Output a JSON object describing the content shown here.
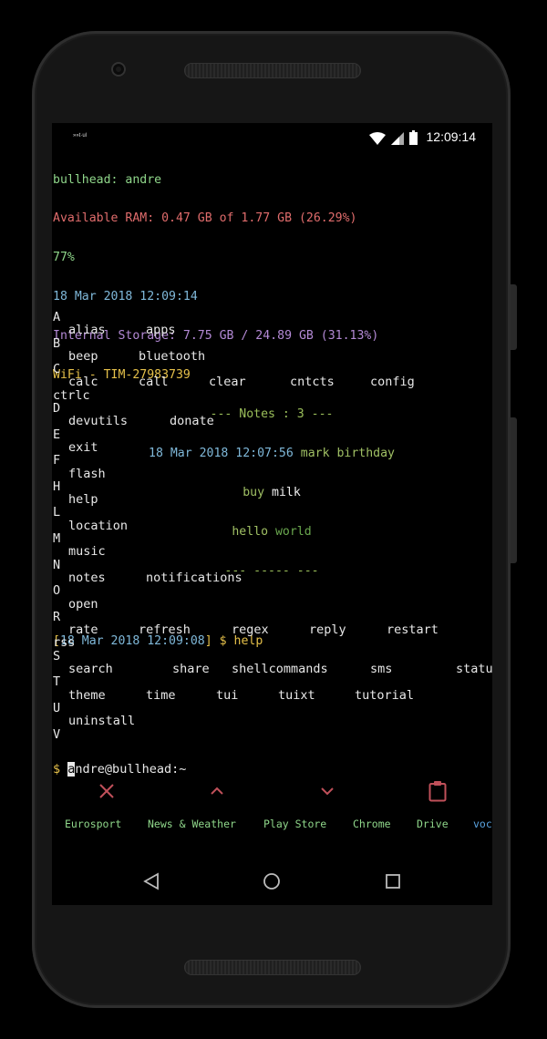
{
  "status_bar": {
    "notification_text": "»»t·ul",
    "clock": "12:09:14",
    "icons": [
      "wifi-icon",
      "signal-icon",
      "battery-icon"
    ]
  },
  "info": {
    "device": "bullhead: andre",
    "ram": "Available RAM: 0.47 GB of 1.77 GB (26.29%)",
    "battery": "77%",
    "datetime": "18 Mar 2018 12:09:14",
    "storage": "Internal Storage: 7.75 GB / 24.89 GB (31.13%)",
    "wifi": "WiFi - TIM-27983739"
  },
  "notes": {
    "header": "--- Notes : 3 ---",
    "note1_date": "18 Mar 2018 12:07:56",
    "note1_text": "mark birthday",
    "note2_a": "buy",
    "note2_b": "milk",
    "note3_a": "hello",
    "note3_b": "world",
    "footer": "--- ----- ---"
  },
  "command": {
    "open_bracket": "[",
    "timestamp": "18 Mar 2018 12:09:08",
    "close_bracket": "]",
    "prompt": "$ help"
  },
  "help": {
    "A": [
      "alias",
      "apps"
    ],
    "B": [
      "beep",
      "bluetooth"
    ],
    "C": [
      "calc",
      "call",
      "clear",
      "cntcts",
      "config"
    ],
    "C_overflow": "ctrlc",
    "D": [
      "devutils",
      "donate"
    ],
    "E": [
      "exit"
    ],
    "F": [
      "flash"
    ],
    "H": [
      "help"
    ],
    "L": [
      "location"
    ],
    "M": [
      "music"
    ],
    "N": [
      "notes",
      "notifications"
    ],
    "O": [
      "open"
    ],
    "R": [
      "rate",
      "refresh",
      "regex",
      "reply",
      "restart"
    ],
    "R_overflow": "rss",
    "S": [
      "search",
      "share",
      "shellcommands",
      "sms",
      "status"
    ],
    "T": [
      "theme",
      "time",
      "tui",
      "tuixt",
      "tutorial"
    ],
    "U": [
      "uninstall"
    ],
    "V_label": "V"
  },
  "input": {
    "dollar": "$",
    "cursor_char": "a",
    "rest": "ndre@bullhead:~"
  },
  "toolbar": {
    "buttons": [
      "close-icon",
      "chevron-up-icon",
      "chevron-down-icon",
      "clipboard-icon"
    ],
    "accent": "#c0505a"
  },
  "suggestions": [
    "Eurosport",
    "News & Weather",
    "Play Store",
    "Chrome",
    "Drive",
    "voc"
  ],
  "navbar": [
    "back-icon",
    "home-icon",
    "recents-icon"
  ]
}
